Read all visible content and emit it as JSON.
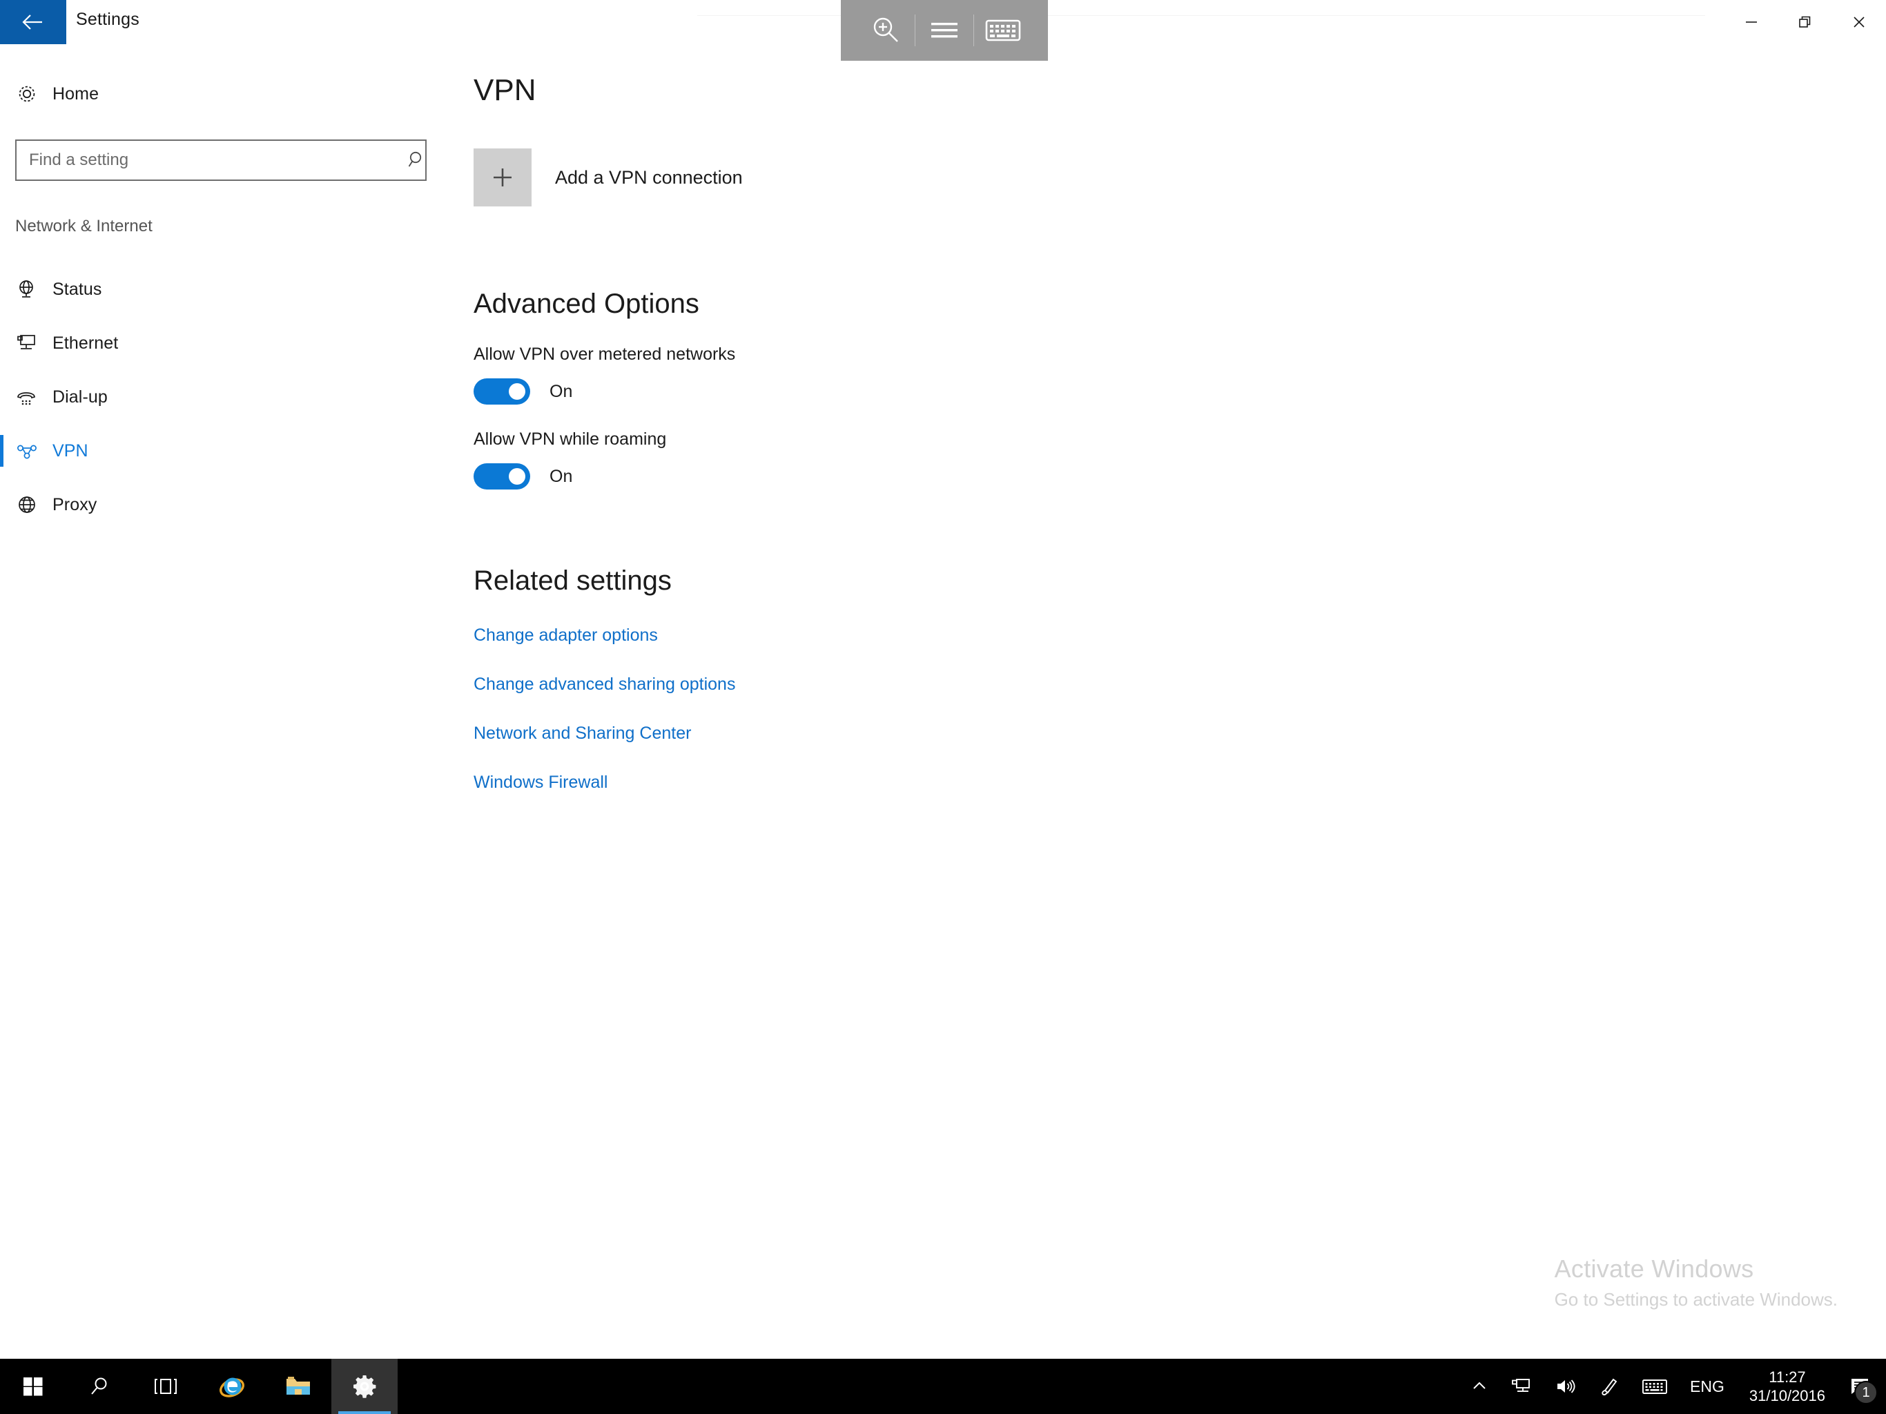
{
  "window": {
    "title": "Settings",
    "back_icon": "back-arrow-icon",
    "controls": {
      "minimize": "minimize-icon",
      "restore": "restore-icon",
      "close": "close-icon"
    }
  },
  "access_toolbar": {
    "magnifier": "magnifier-plus-icon",
    "menu": "hamburger-menu-icon",
    "keyboard": "on-screen-keyboard-icon"
  },
  "sidebar": {
    "home": {
      "label": "Home",
      "icon": "gear-icon"
    },
    "search": {
      "value": "",
      "placeholder": "Find a setting",
      "icon": "search-icon"
    },
    "category": "Network & Internet",
    "items": [
      {
        "label": "Status",
        "icon": "globe-monitor-icon",
        "selected": false
      },
      {
        "label": "Ethernet",
        "icon": "ethernet-monitor-icon",
        "selected": false
      },
      {
        "label": "Dial-up",
        "icon": "phone-handset-icon",
        "selected": false
      },
      {
        "label": "VPN",
        "icon": "vpn-icon",
        "selected": true
      },
      {
        "label": "Proxy",
        "icon": "globe-icon",
        "selected": false
      }
    ]
  },
  "main": {
    "title": "VPN",
    "add_connection": {
      "label": "Add a VPN connection",
      "icon": "plus-icon"
    },
    "advanced": {
      "heading": "Advanced Options",
      "options": [
        {
          "label": "Allow VPN over metered networks",
          "state": "On",
          "on": true
        },
        {
          "label": "Allow VPN while roaming",
          "state": "On",
          "on": true
        }
      ]
    },
    "related": {
      "heading": "Related settings",
      "links": [
        "Change adapter options",
        "Change advanced sharing options",
        "Network and Sharing Center",
        "Windows Firewall"
      ]
    }
  },
  "watermark": {
    "line1": "Activate Windows",
    "line2": "Go to Settings to activate Windows."
  },
  "taskbar": {
    "items": [
      {
        "name": "start-button",
        "icon": "windows-logo-icon",
        "active": false
      },
      {
        "name": "search-button",
        "icon": "search-icon",
        "active": false
      },
      {
        "name": "task-view-button",
        "icon": "task-view-icon",
        "active": false
      },
      {
        "name": "internet-explorer",
        "icon": "internet-explorer-icon",
        "active": false
      },
      {
        "name": "file-explorer",
        "icon": "file-explorer-icon",
        "active": false
      },
      {
        "name": "settings-app",
        "icon": "gear-icon",
        "active": true
      }
    ],
    "tray": {
      "chevron": "chevron-up-icon",
      "network": "network-icon",
      "volume": "volume-icon",
      "pen": "pen-icon",
      "keyboard": "touch-keyboard-icon",
      "language": "ENG",
      "time": "11:27",
      "date": "31/10/2016",
      "notification_icon": "notification-center-icon",
      "notification_count": "1"
    }
  },
  "colors": {
    "accent": "#0f79d8",
    "titlebar_back": "#0a5ca8",
    "toggle_on": "#0b79d5",
    "link": "#0f6fc9",
    "taskbar": "#000000"
  }
}
